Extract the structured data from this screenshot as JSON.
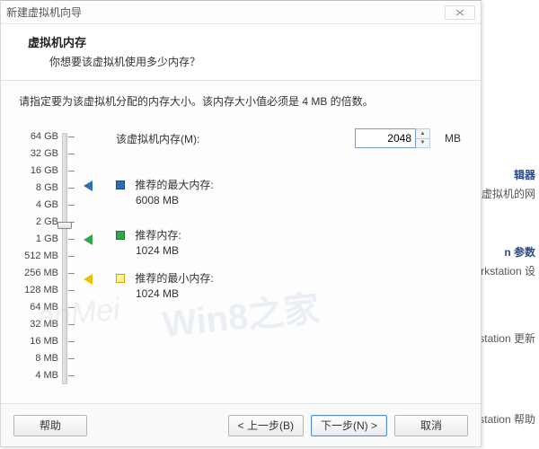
{
  "dialog": {
    "title": "新建虚拟机向导",
    "header_title": "虚拟机内存",
    "header_subtitle": "你想要该虚拟机使用多少内存？",
    "instruction": "请指定要为该虚拟机分配的内存大小。该内存大小值必须是 4 MB 的倍数。"
  },
  "memory": {
    "label": "该虚拟机内存(M):",
    "value": "2048",
    "unit": "MB",
    "scale": [
      "64 GB",
      "32 GB",
      "16 GB",
      "8 GB",
      "4 GB",
      "2 GB",
      "1 GB",
      "512 MB",
      "256 MB",
      "128 MB",
      "64 MB",
      "32 MB",
      "16 MB",
      "8 MB",
      "4 MB"
    ]
  },
  "recommendations": {
    "max_label": "推荐的最大内存:",
    "max_value": "6008 MB",
    "rec_label": "推荐内存:",
    "rec_value": "1024 MB",
    "min_label": "推荐的最小内存:",
    "min_value": "1024 MB"
  },
  "buttons": {
    "help": "帮助",
    "back": "< 上一步(B)",
    "next": "下一步(N) >",
    "cancel": "取消"
  },
  "background_fragments": {
    "a": "辑器",
    "b": "机上的虚拟机的网",
    "c": "n 参数",
    "d": "are Workstation 设",
    "e": "Workstation 更新",
    "f": "Workstation 帮助"
  },
  "watermark": {
    "primary": "Win8之家",
    "secondary": "anMei"
  }
}
